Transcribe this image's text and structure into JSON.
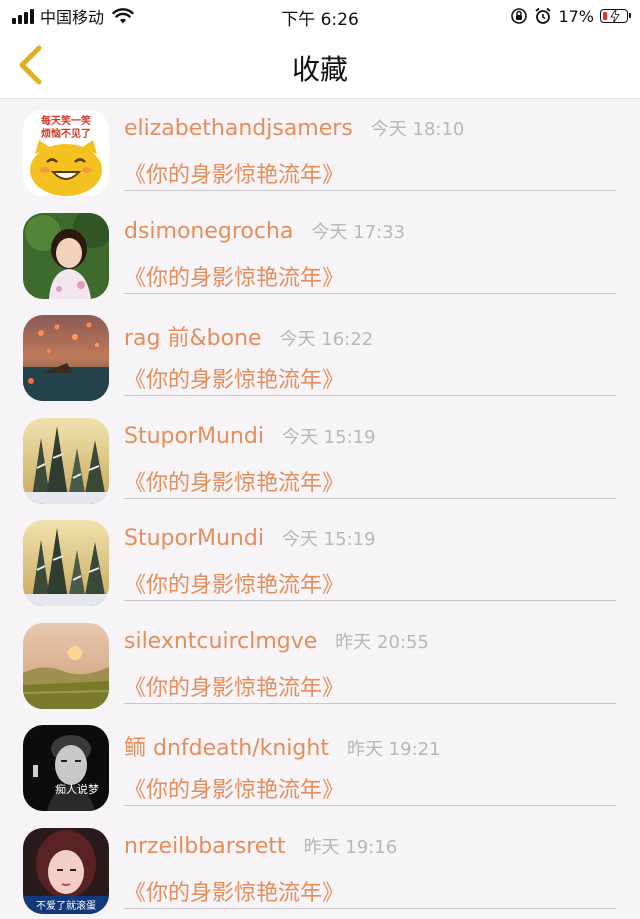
{
  "status_bar": {
    "carrier": "中国移动",
    "time": "下午 6:26",
    "battery_percent": "17%",
    "battery_level": 0.17,
    "icons": [
      "signal-icon",
      "wifi-icon",
      "orientation-lock-icon",
      "alarm-icon",
      "battery-icon"
    ]
  },
  "nav": {
    "title": "收藏",
    "back_icon": "chevron-left-icon",
    "accent_color": "#e0b020"
  },
  "colors": {
    "name_color": "#e48e5c",
    "time_color": "#b8b8b8"
  },
  "favorites": [
    {
      "name": "elizabethandjsamers",
      "time": "今天 18:10",
      "song": "《你的身影惊艳流年》",
      "avatar_text": "每天笑一笑 烦恼不见了"
    },
    {
      "name": "dsimonegrocha",
      "time": "今天 17:33",
      "song": "《你的身影惊艳流年》",
      "avatar_text": ""
    },
    {
      "name": "rag 前&bone",
      "time": "今天 16:22",
      "song": "《你的身影惊艳流年》",
      "avatar_text": ""
    },
    {
      "name": "StuporMundi",
      "time": "今天 15:19",
      "song": "《你的身影惊艳流年》",
      "avatar_text": ""
    },
    {
      "name": "StuporMundi",
      "time": "今天 15:19",
      "song": "《你的身影惊艳流年》",
      "avatar_text": ""
    },
    {
      "name": "silexntcuirclmgve",
      "time": "昨天 20:55",
      "song": "《你的身影惊艳流年》",
      "avatar_text": ""
    },
    {
      "name": "鲕 dnfdeath/knight",
      "time": "昨天 19:21",
      "song": "《你的身影惊艳流年》",
      "avatar_text": "痴人说梦"
    },
    {
      "name": "nrzeilbbarsrett",
      "time": "昨天 19:16",
      "song": "《你的身影惊艳流年》",
      "avatar_text": "不爱了就滚蛋"
    }
  ]
}
